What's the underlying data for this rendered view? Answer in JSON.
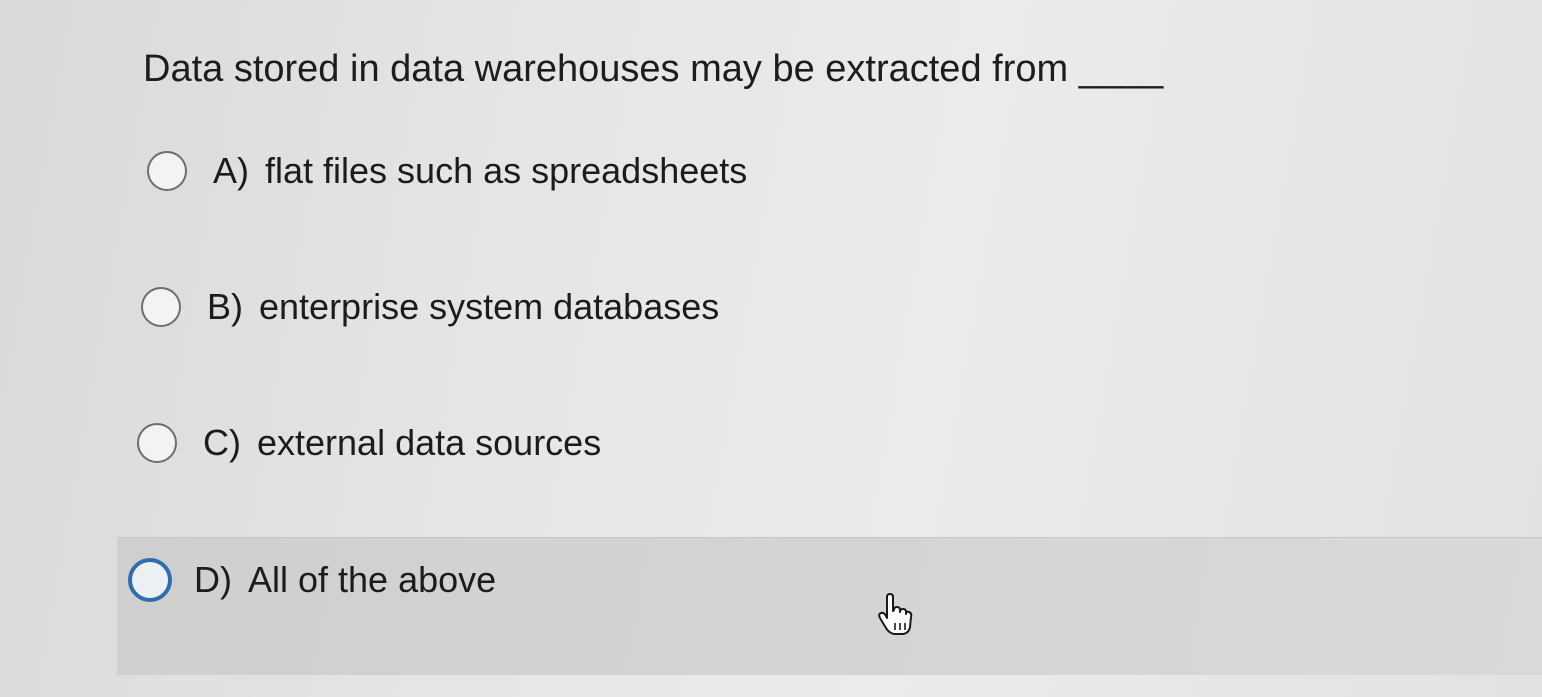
{
  "question": {
    "text": "Data stored in data warehouses may be extracted from ____"
  },
  "options": [
    {
      "letter": "A)",
      "text": "flat files such as spreadsheets",
      "selected": false
    },
    {
      "letter": "B)",
      "text": "enterprise system databases",
      "selected": false
    },
    {
      "letter": "C)",
      "text": "external data sources",
      "selected": false
    },
    {
      "letter": "D)",
      "text": "All of the above",
      "selected": false,
      "hovered": true
    }
  ],
  "colors": {
    "focus_ring": "#2f6db0",
    "hover_band": "#d2d2d0"
  },
  "cursor": {
    "icon": "hand-pointer-icon"
  }
}
